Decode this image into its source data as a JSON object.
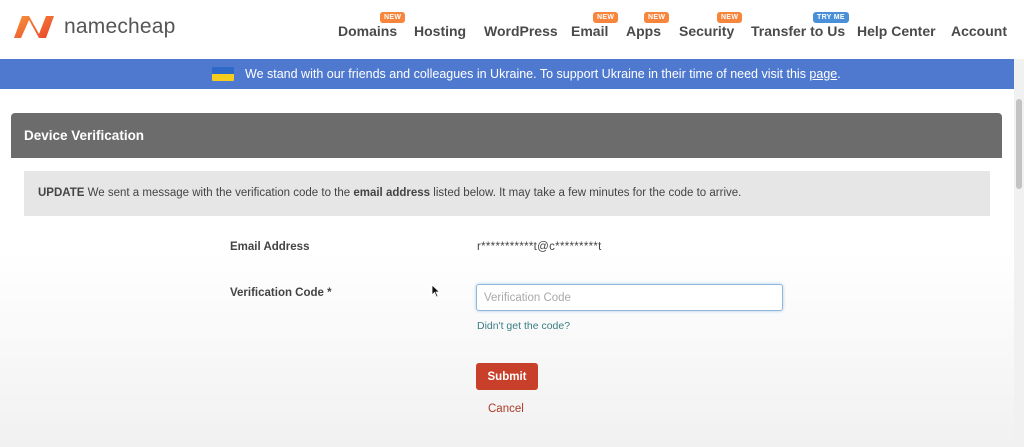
{
  "brand": {
    "name": "namecheap",
    "logo_icon": "namecheap-n-logo",
    "colors": {
      "logo_start": "#f26b21",
      "logo_end": "#e8452c"
    }
  },
  "nav": {
    "items": [
      {
        "label": "Domains",
        "badge": "NEW"
      },
      {
        "label": "Hosting",
        "badge": ""
      },
      {
        "label": "WordPress",
        "badge": ""
      },
      {
        "label": "Email",
        "badge": "NEW"
      },
      {
        "label": "Apps",
        "badge": "NEW"
      },
      {
        "label": "Security",
        "badge": "NEW"
      },
      {
        "label": "Transfer to Us",
        "badge": "TRY ME"
      },
      {
        "label": "Help Center",
        "badge": ""
      },
      {
        "label": "Account",
        "badge": ""
      }
    ]
  },
  "banner": {
    "text": "We stand with our friends and colleagues in Ukraine. To support Ukraine in their time of need visit this",
    "link": "page",
    "suffix": ".",
    "flag_icon": "ukraine-flag-icon",
    "color": "#4f79cf"
  },
  "card": {
    "title": "Device Verification"
  },
  "notice": {
    "prefix": "UPDATE",
    "text1": " We sent a message with the verification code to the ",
    "strong": "email address",
    "text2": " listed below. It may take a few minutes for the code to arrive."
  },
  "form": {
    "email_label": "Email Address",
    "email_value": "r***********t@c*********t",
    "code_label": "Verification Code *",
    "code_placeholder": "Verification Code",
    "code_value": "",
    "help_link": "Didn't get the code?",
    "submit_label": "Submit",
    "cancel_label": "Cancel",
    "submit_color": "#c83f2a"
  }
}
